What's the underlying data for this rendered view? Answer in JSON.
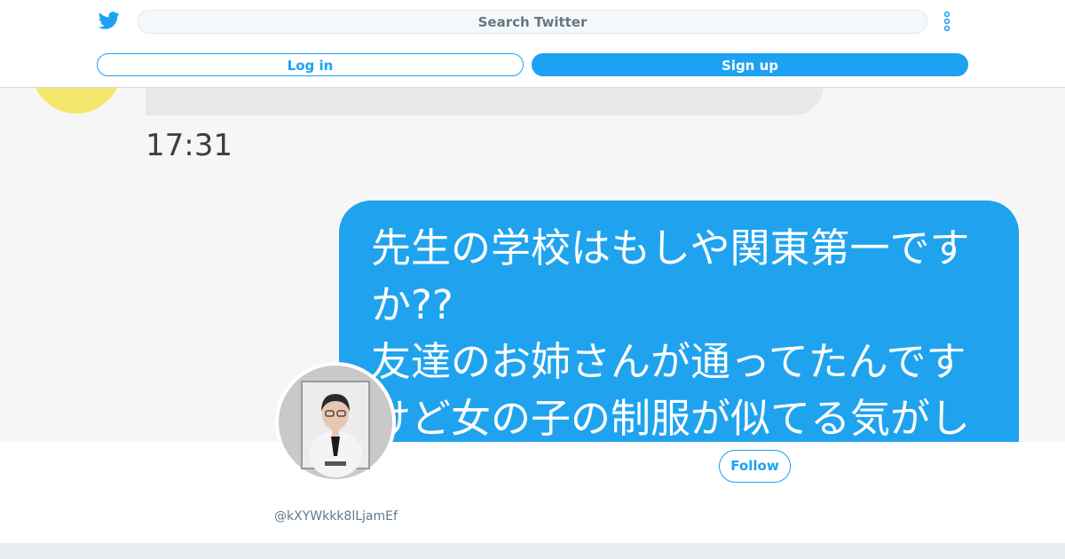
{
  "header": {
    "search_placeholder": "Search Twitter",
    "login_label": "Log in",
    "signup_label": "Sign up"
  },
  "banner": {
    "time": "17:31",
    "message_lines": [
      "先生の学校はもしや関東第一です",
      "か??",
      "友達のお姉さんが通ってたんです",
      "けど女の子の制服が似てる気がし"
    ]
  },
  "profile": {
    "handle": "@kXYWkkk8lLjamEf",
    "follow_label": "Follow"
  },
  "colors": {
    "twitter_blue": "#1da1f2",
    "chat_blue": "#1fa3ef",
    "muted_text": "#657786"
  },
  "icons": [
    "twitter-logo-icon",
    "more-options-icon"
  ]
}
